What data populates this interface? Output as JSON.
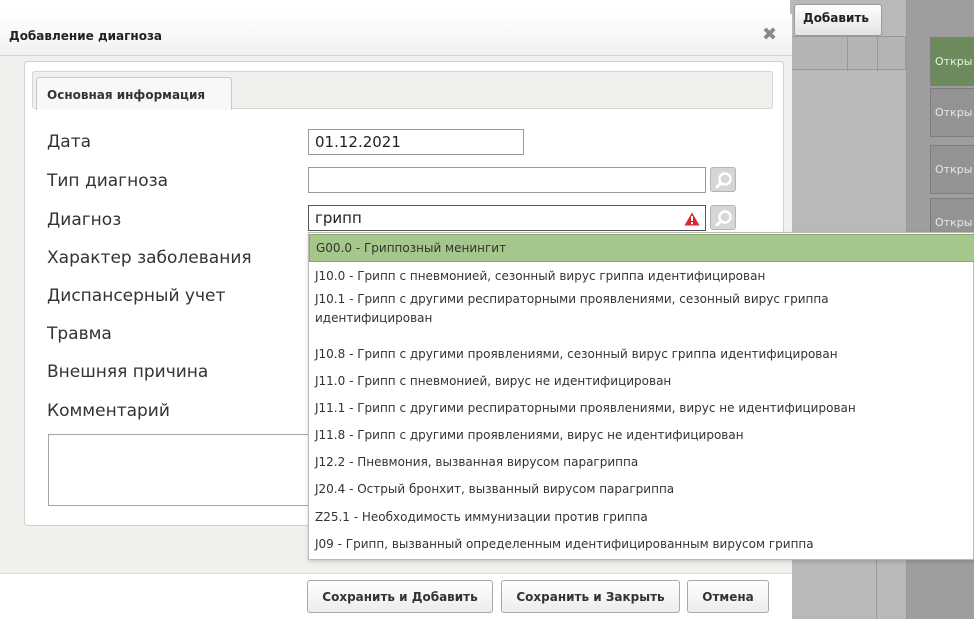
{
  "background": {
    "add_button": "Добавить",
    "open_cells": [
      "Откры",
      "Откры",
      "Откры",
      "Откры"
    ]
  },
  "dialog": {
    "title": "Добавление диагноза",
    "close_glyph": "✖",
    "tab_label": "Основная информация",
    "fields": {
      "date_label": "Дата",
      "date_value": "01.12.2021",
      "diag_type_label": "Тип диагноза",
      "diag_type_value": "",
      "diagnosis_label": "Диагноз",
      "diagnosis_value": "грипп",
      "character_label": "Характер заболевания",
      "dispensary_label": "Диспансерный учет",
      "injury_label": "Травма",
      "external_cause_label": "Внешняя причина",
      "comment_label": "Комментарий",
      "comment_value": ""
    },
    "buttons": {
      "save_add": "Сохранить и Добавить",
      "save_close": "Сохранить и Закрыть",
      "cancel": "Отмена"
    }
  },
  "dropdown": {
    "items": [
      "G00.0 - Гриппозный менингит",
      "J10.0 - Грипп с пневмонией, сезонный вирус гриппа идентифицирован",
      "J10.1 - Грипп с другими респираторными проявлениями, сезонный вирус гриппа идентифицирован",
      "J10.8 - Грипп с другими проявлениями, сезонный вирус гриппа идентифицирован",
      "J11.0 - Грипп с пневмонией, вирус не идентифицирован",
      "J11.1 - Грипп с другими респираторными проявлениями, вирус не идентифицирован",
      "J11.8 - Грипп с другими проявлениями, вирус не идентифицирован",
      "J12.2 - Пневмония, вызванная вирусом парагриппа",
      "J20.4 - Острый бронхит, вызванный вирусом парагриппа",
      "Z25.1 - Необходимость иммунизации против гриппа",
      "J09 - Грипп, вызванный определенным идентифицированным вирусом гриппа"
    ],
    "selected_index": 0
  },
  "colors": {
    "selected_item": "#a6c78c",
    "warning": "#d9262b",
    "dialog_body": "#f0f0ed"
  },
  "icons": [
    "close-icon",
    "search-icon",
    "warning-icon"
  ]
}
